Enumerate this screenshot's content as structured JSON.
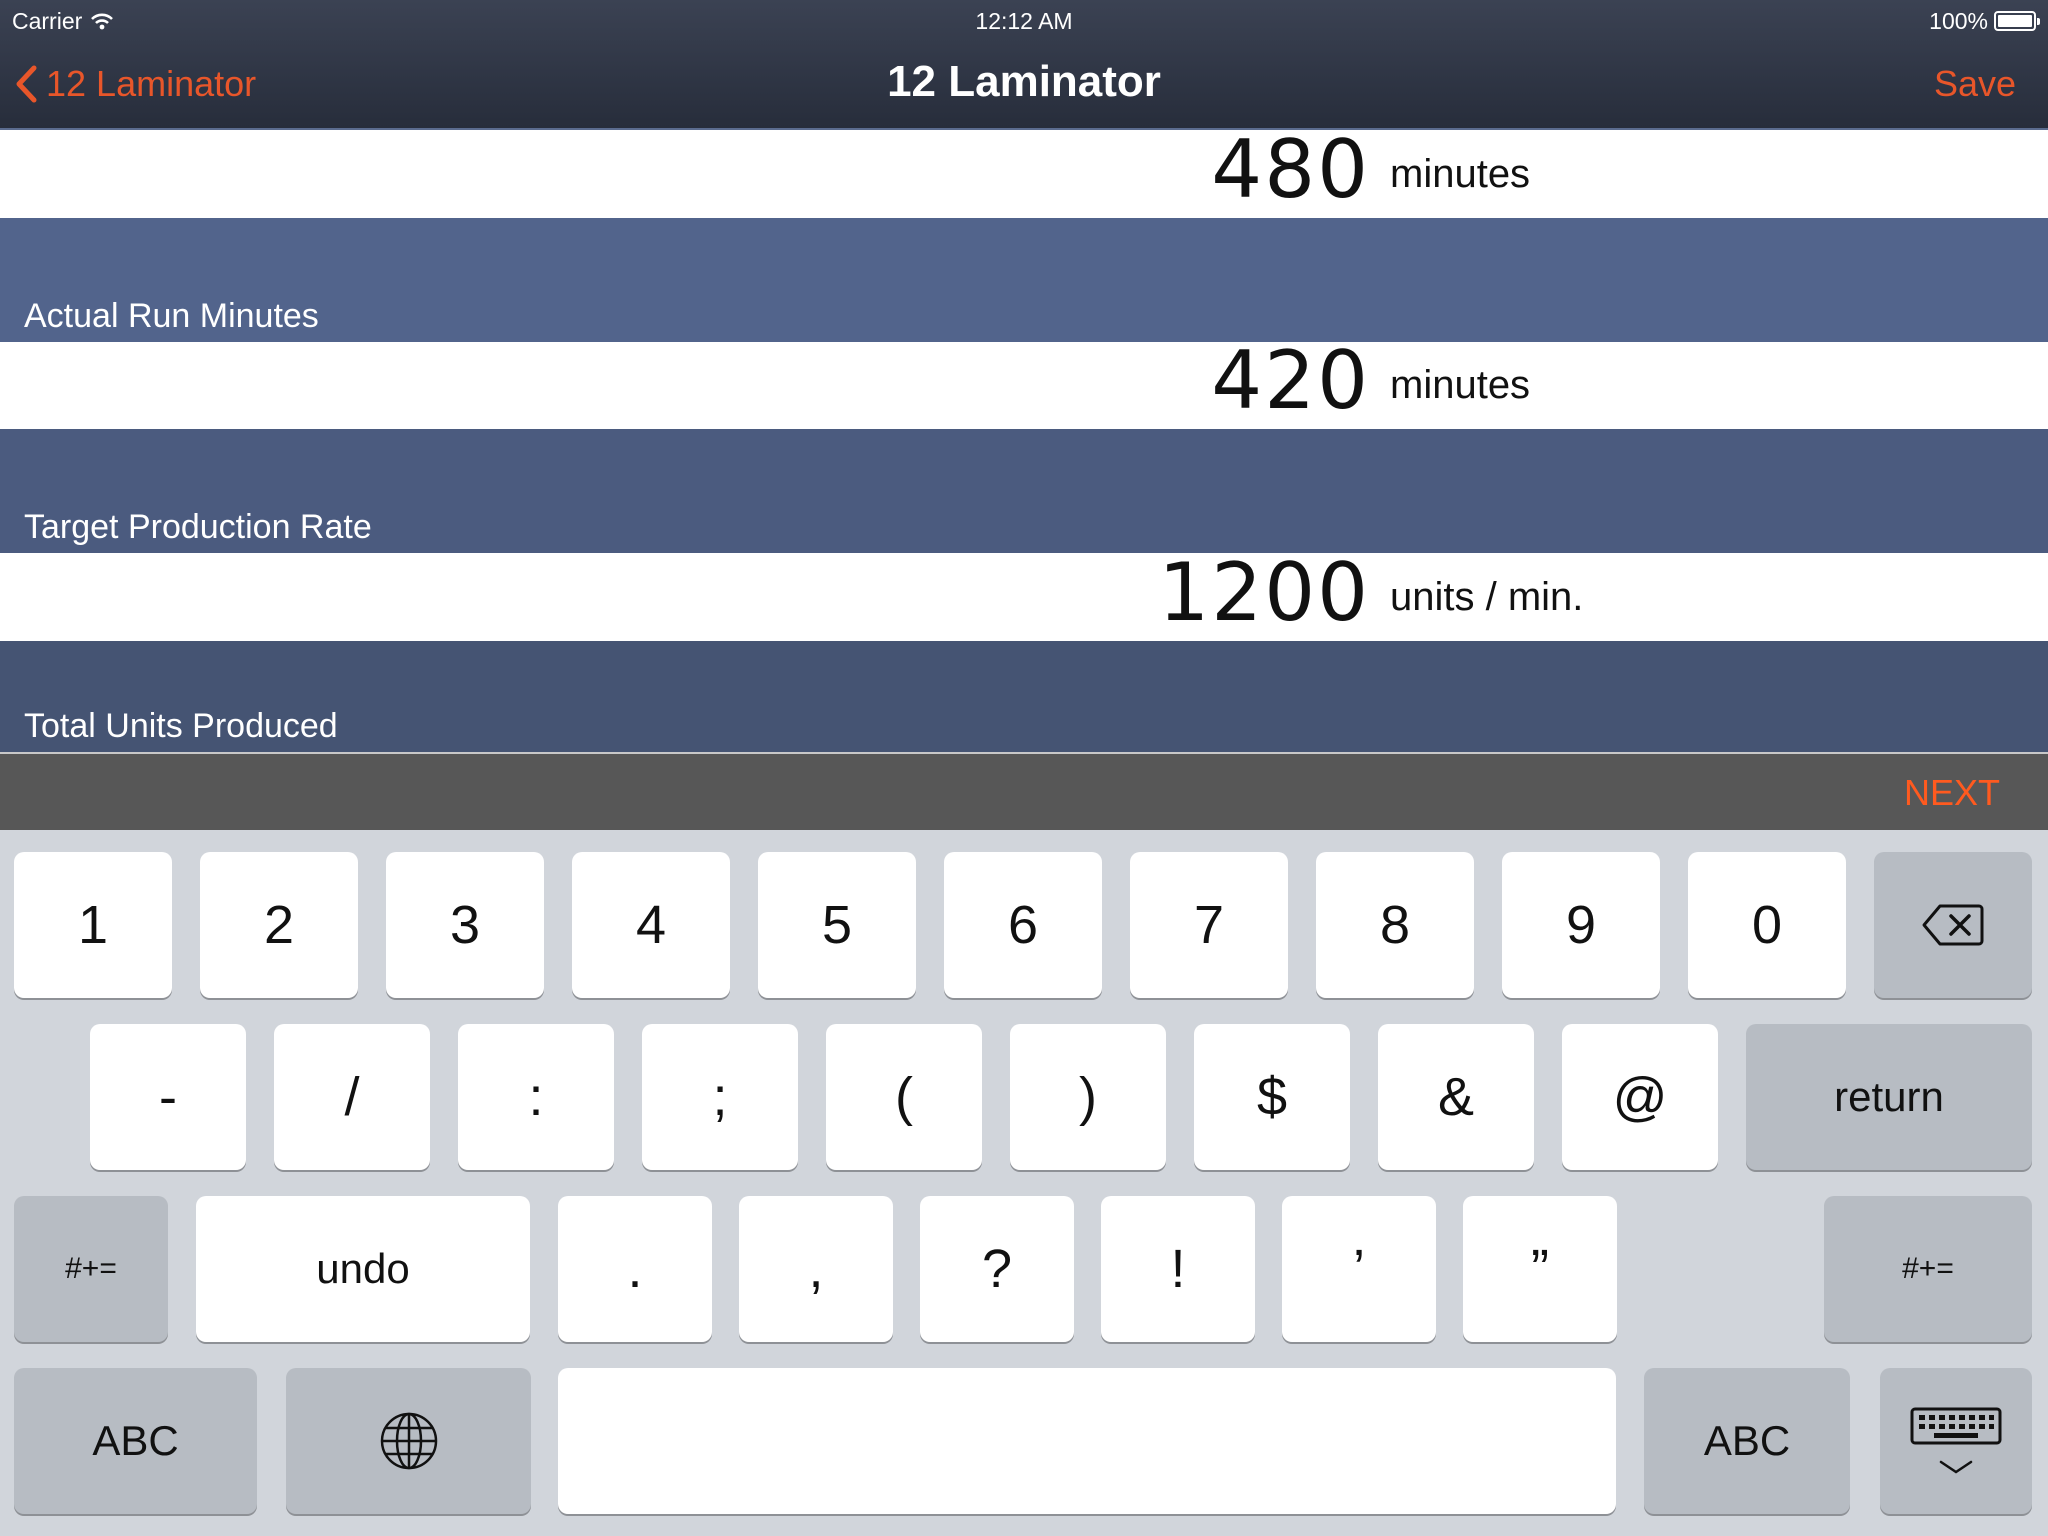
{
  "status_bar": {
    "carrier": "Carrier",
    "time": "12:12 AM",
    "battery": "100%"
  },
  "nav": {
    "back_label": "12 Laminator",
    "title": "12 Laminator",
    "save_label": "Save"
  },
  "rows": [
    {
      "value": "480",
      "unit": "minutes"
    },
    {
      "label": "Actual Run Minutes",
      "value": "420",
      "unit": "minutes"
    },
    {
      "label": "Target Production Rate",
      "value": "1200",
      "unit": "units / min."
    },
    {
      "label": "Total Units Produced"
    }
  ],
  "accessory": {
    "next_label": "NEXT"
  },
  "keyboard": {
    "row1": [
      "1",
      "2",
      "3",
      "4",
      "5",
      "6",
      "7",
      "8",
      "9",
      "0"
    ],
    "row2": [
      "-",
      "/",
      ":",
      ";",
      "(",
      ")",
      "$",
      "&",
      "@"
    ],
    "return_label": "return",
    "symbols_label": "#+=",
    "undo_label": "undo",
    "row3": [
      ".",
      ",",
      "?",
      "!",
      "’",
      "”"
    ],
    "abc_label": "ABC"
  },
  "colors": {
    "accent": "#e8562a",
    "next": "#ff5a1f",
    "label_row": "#52648c",
    "nav_bg": "#2f3545"
  }
}
